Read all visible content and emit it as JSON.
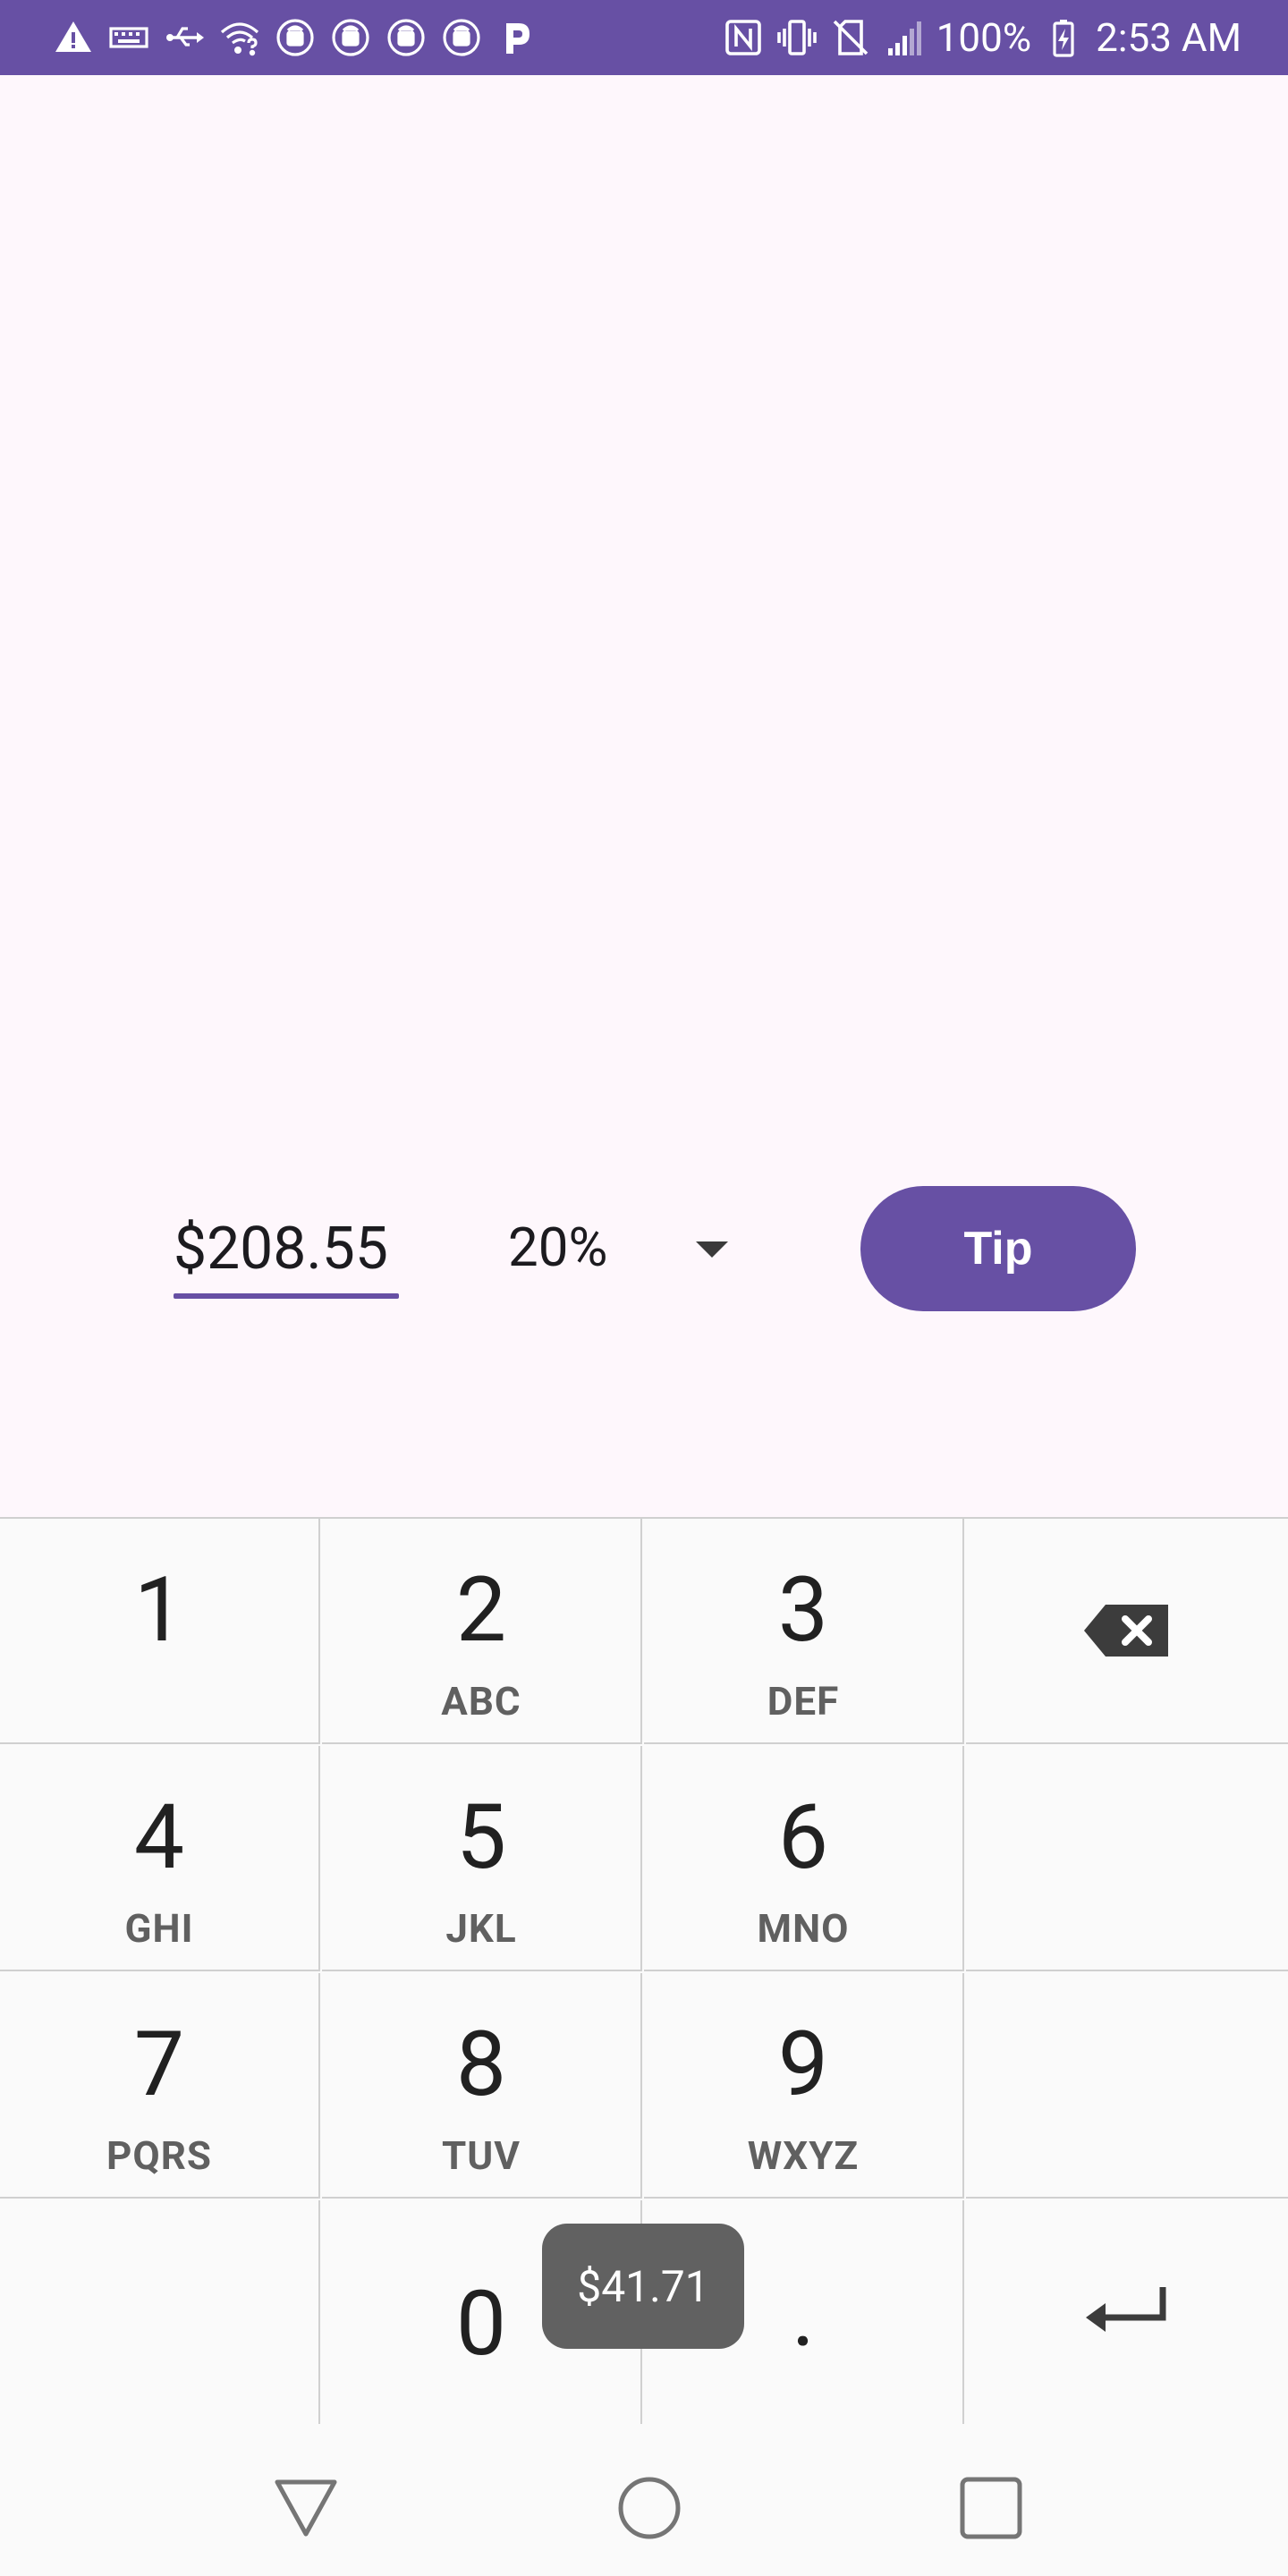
{
  "status_bar": {
    "battery": "100%",
    "time": "2:53 AM",
    "left_icons": [
      "warning-icon",
      "keyboard-icon",
      "usb-icon",
      "wifi-question-icon",
      "android-sync-icon",
      "android-sync-icon",
      "android-sync-icon",
      "android-sync-icon",
      "parking-p-icon"
    ],
    "right_icons": [
      "nfc-icon",
      "vibrate-icon",
      "no-sim-icon",
      "signal-icon",
      "battery-charging-icon"
    ]
  },
  "form": {
    "amount": "$208.55",
    "percent": "20%",
    "tip_button": "Tip"
  },
  "keypad": {
    "keys": [
      {
        "digit": "1",
        "letters": ""
      },
      {
        "digit": "2",
        "letters": "ABC"
      },
      {
        "digit": "3",
        "letters": "DEF"
      },
      {
        "digit": "4",
        "letters": "GHI"
      },
      {
        "digit": "5",
        "letters": "JKL"
      },
      {
        "digit": "6",
        "letters": "MNO"
      },
      {
        "digit": "7",
        "letters": "PQRS"
      },
      {
        "digit": "8",
        "letters": "TUV"
      },
      {
        "digit": "9",
        "letters": "WXYZ"
      },
      {
        "digit": "0",
        "letters": ""
      },
      {
        "digit": ".",
        "letters": ""
      }
    ]
  },
  "toast": "$41.71",
  "colors": {
    "accent": "#6750a4",
    "background": "#fef7fc"
  }
}
